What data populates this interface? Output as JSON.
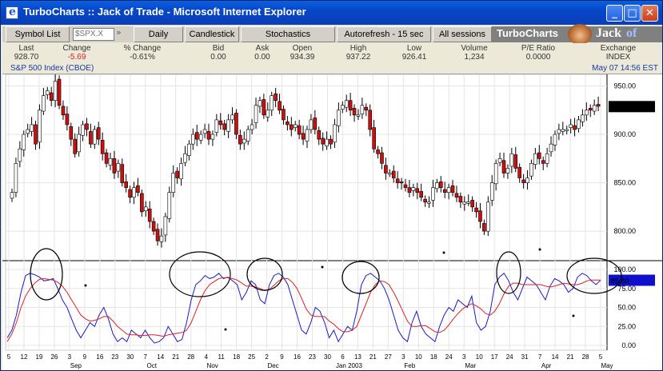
{
  "window": {
    "title": "TurboCharts :: Jack of Trade - Microsoft Internet Explorer",
    "minimize": "_",
    "maximize": "□",
    "close": "✕"
  },
  "toolbar": {
    "symbol_list": "Symbol List",
    "symbol_input": "$SPX.X",
    "symbol_arrows": "»",
    "period": "Daily",
    "chart_style": "Candlestick",
    "indicator": "Stochastics",
    "autorefresh": "Autorefresh - 15 sec",
    "sessions": "All sessions"
  },
  "brand": {
    "name": "TurboCharts",
    "jack": "Jack",
    "of": "of"
  },
  "quote": {
    "fields": [
      {
        "label": "Last",
        "value": "928.70",
        "color": "#333333"
      },
      {
        "label": "Change",
        "value": "-5.69",
        "color": "#e02020"
      },
      {
        "label": "% Change",
        "value": "-0.61%",
        "color": "#333333"
      },
      {
        "label": "Bid",
        "value": "0.00",
        "color": "#333333"
      },
      {
        "label": "Ask",
        "value": "0.00",
        "color": "#333333"
      },
      {
        "label": "Open",
        "value": "934.39",
        "color": "#333333"
      },
      {
        "label": "High",
        "value": "937.22",
        "color": "#333333"
      },
      {
        "label": "Low",
        "value": "926.41",
        "color": "#333333"
      },
      {
        "label": "Volume",
        "value": "1,234",
        "color": "#333333"
      },
      {
        "label": "P/E Ratio",
        "value": "0.0000",
        "color": "#333333"
      },
      {
        "label": "Exchange",
        "value": "INDEX",
        "color": "#333333"
      }
    ],
    "symbol_name": "S&P 500 Index (CBOE)",
    "timestamp": "May 07 14:56 EST"
  },
  "chart_data": [
    {
      "type": "candlestick",
      "y_ticks": [
        "950.00",
        "900.00",
        "850.00",
        "800.00"
      ],
      "ylim": [
        772,
        962
      ],
      "last_price_label": "928.70",
      "close": [
        840,
        870,
        885,
        900,
        905,
        910,
        890,
        925,
        940,
        945,
        935,
        955,
        930,
        920,
        910,
        895,
        880,
        900,
        910,
        905,
        890,
        905,
        895,
        880,
        870,
        875,
        860,
        870,
        850,
        845,
        835,
        845,
        840,
        820,
        825,
        810,
        800,
        790,
        795,
        815,
        840,
        860,
        855,
        870,
        880,
        890,
        900,
        895,
        900,
        905,
        895,
        900,
        915,
        910,
        905,
        915,
        920,
        900,
        890,
        895,
        905,
        910,
        930,
        935,
        920,
        925,
        940,
        935,
        925,
        915,
        910,
        905,
        910,
        900,
        895,
        905,
        915,
        905,
        895,
        890,
        895,
        890,
        910,
        925,
        930,
        935,
        925,
        920,
        920,
        930,
        925,
        905,
        885,
        880,
        870,
        860,
        860,
        855,
        850,
        850,
        845,
        840,
        845,
        840,
        835,
        830,
        830,
        845,
        850,
        845,
        840,
        845,
        840,
        835,
        830,
        830,
        830,
        825,
        820,
        810,
        800,
        830,
        850,
        870,
        875,
        860,
        865,
        880,
        865,
        855,
        850,
        855,
        870,
        880,
        875,
        870,
        880,
        890,
        900,
        905,
        905,
        905,
        910,
        905,
        915,
        920,
        925,
        925,
        930,
        929
      ]
    },
    {
      "type": "line",
      "series": [
        {
          "name": "%K",
          "color": "#1a1acc",
          "values": [
            10,
            20,
            40,
            70,
            92,
            95,
            93,
            90,
            85,
            86,
            88,
            75,
            60,
            50,
            35,
            20,
            10,
            20,
            30,
            25,
            40,
            50,
            35,
            15,
            5,
            10,
            5,
            20,
            15,
            10,
            20,
            10,
            3,
            5,
            10,
            25,
            15,
            5,
            8,
            30,
            60,
            80,
            85,
            92,
            88,
            90,
            95,
            88,
            90,
            85,
            80,
            60,
            70,
            85,
            80,
            60,
            55,
            80,
            92,
            95,
            90,
            80,
            60,
            40,
            20,
            15,
            30,
            50,
            45,
            30,
            10,
            20,
            5,
            15,
            25,
            20,
            45,
            80,
            92,
            95,
            90,
            85,
            75,
            60,
            40,
            20,
            10,
            5,
            30,
            45,
            25,
            15,
            10,
            5,
            25,
            40,
            50,
            45,
            60,
            55,
            50,
            65,
            30,
            20,
            25,
            45,
            80,
            90,
            95,
            85,
            70,
            60,
            75,
            90,
            85,
            80,
            70,
            60,
            78,
            88,
            85,
            80,
            70,
            75,
            90,
            95,
            92,
            85,
            80,
            86
          ]
        },
        {
          "name": "%D",
          "color": "#dd2020",
          "values": [
            5,
            15,
            30,
            50,
            65,
            75,
            82,
            87,
            88,
            87,
            86,
            83,
            78,
            70,
            60,
            50,
            40,
            35,
            32,
            33,
            35,
            38,
            38,
            32,
            25,
            20,
            15,
            14,
            14,
            13,
            13,
            14,
            14,
            13,
            12,
            14,
            15,
            16,
            17,
            20,
            30,
            45,
            60,
            72,
            80,
            84,
            88,
            89,
            89,
            88,
            86,
            82,
            78,
            78,
            77,
            75,
            72,
            74,
            79,
            85,
            88,
            88,
            83,
            75,
            62,
            48,
            40,
            38,
            38,
            38,
            32,
            28,
            22,
            18,
            18,
            20,
            25,
            40,
            55,
            70,
            80,
            85,
            84,
            80,
            70,
            58,
            45,
            32,
            25,
            25,
            26,
            26,
            22,
            18,
            17,
            20,
            27,
            35,
            42,
            48,
            52,
            55,
            52,
            48,
            42,
            40,
            45,
            55,
            68,
            78,
            82,
            82,
            80,
            80,
            80,
            80,
            80,
            78,
            77,
            78,
            80,
            82,
            81,
            80,
            80,
            82,
            85,
            86,
            86,
            86
          ]
        }
      ],
      "y_ticks": [
        "100.00",
        "75.00",
        "50.00",
        "25.00",
        "0.00"
      ],
      "ylim": [
        0,
        100
      ],
      "last_value_label": "85.80",
      "annotations": "black ellipses circling overbought peaks"
    }
  ],
  "x_axis": {
    "day_ticks": [
      "5",
      "12",
      "19",
      "26",
      "3",
      "9",
      "16",
      "23",
      "30",
      "7",
      "14",
      "21",
      "28",
      "4",
      "11",
      "18",
      "25",
      "2",
      "9",
      "16",
      "23",
      "30",
      "6",
      "13",
      "21",
      "27",
      "3",
      "10",
      "18",
      "24",
      "3",
      "10",
      "17",
      "24",
      "31",
      "7",
      "14",
      "21",
      "28",
      "5"
    ],
    "month_labels": [
      "Sep",
      "Oct",
      "Nov",
      "Dec",
      "Jan 2003",
      "Feb",
      "Mar",
      "Apr",
      "May"
    ]
  }
}
